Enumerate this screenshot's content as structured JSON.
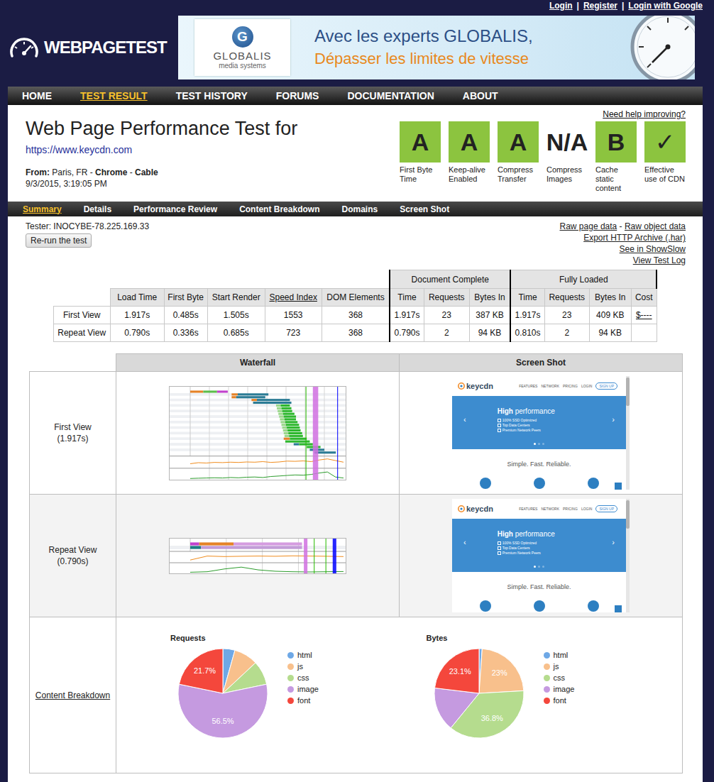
{
  "top_links": {
    "items": [
      "Login",
      "Register",
      "Login with Google"
    ],
    "separator": "|"
  },
  "logo": {
    "text": "WEBPAGETEST"
  },
  "ad": {
    "logo_letter": "G",
    "brand": "GLOBALIS",
    "brand_sub": "media systems",
    "line1": "Avec les experts GLOBALIS,",
    "line2": "Dépasser les limites de vitesse"
  },
  "nav": [
    {
      "label": "HOME",
      "selected": false
    },
    {
      "label": "TEST RESULT",
      "selected": true
    },
    {
      "label": "TEST HISTORY",
      "selected": false
    },
    {
      "label": "FORUMS",
      "selected": false
    },
    {
      "label": "DOCUMENTATION",
      "selected": false
    },
    {
      "label": "ABOUT",
      "selected": false
    }
  ],
  "header": {
    "title": "Web Page Performance Test for",
    "url": "https://www.keycdn.com",
    "from": [
      {
        "text": "From:",
        "bold": true
      },
      {
        "text": " Paris, FR - ",
        "bold": false
      },
      {
        "text": "Chrome",
        "bold": true
      },
      {
        "text": " - ",
        "bold": false
      },
      {
        "text": "Cable",
        "bold": true
      }
    ],
    "date": "9/3/2015, 3:19:05 PM",
    "help_link": "Need help improving?"
  },
  "grades": [
    {
      "grade": "A",
      "label": "First Byte Time",
      "color": "#8cc43f"
    },
    {
      "grade": "A",
      "label": "Keep-alive Enabled",
      "color": "#8cc43f"
    },
    {
      "grade": "A",
      "label": "Compress Transfer",
      "color": "#8cc43f"
    },
    {
      "grade": "N/A",
      "label": "Compress Images",
      "color": "#ffffff"
    },
    {
      "grade": "B",
      "label": "Cache static content",
      "color": "#8cc43f"
    },
    {
      "grade": "✓",
      "label": "Effective use of CDN",
      "color": "#8cc43f"
    }
  ],
  "subnav": [
    {
      "label": "Summary",
      "selected": true
    },
    {
      "label": "Details",
      "selected": false
    },
    {
      "label": "Performance Review",
      "selected": false
    },
    {
      "label": "Content Breakdown",
      "selected": false
    },
    {
      "label": "Domains",
      "selected": false
    },
    {
      "label": "Screen Shot",
      "selected": false
    }
  ],
  "tester": {
    "text": "Tester: INOCYBE-78.225.169.33",
    "button": "Re-run the test"
  },
  "links": {
    "separator": " - ",
    "lines": [
      [
        "Raw page data",
        "Raw object data"
      ],
      [
        "Export HTTP Archive (.har)"
      ],
      [
        "See in ShowSlow"
      ],
      [
        "View Test Log"
      ]
    ]
  },
  "results": {
    "groups": [
      "Document Complete",
      "Fully Loaded"
    ],
    "columns": [
      {
        "label": "Load Time",
        "link": false
      },
      {
        "label": "First Byte",
        "link": false
      },
      {
        "label": "Start Render",
        "link": false
      },
      {
        "label": "Speed Index",
        "link": true
      },
      {
        "label": "DOM Elements",
        "link": false
      },
      {
        "label": "Time",
        "link": false
      },
      {
        "label": "Requests",
        "link": false
      },
      {
        "label": "Bytes In",
        "link": false
      },
      {
        "label": "Time",
        "link": false
      },
      {
        "label": "Requests",
        "link": false
      },
      {
        "label": "Bytes In",
        "link": false
      },
      {
        "label": "Cost",
        "link": false
      }
    ],
    "rows": [
      {
        "label": "First View",
        "cells": [
          "1.917s",
          "0.485s",
          "1.505s",
          "1553",
          "368",
          "1.917s",
          "23",
          "387 KB",
          "1.917s",
          "23",
          "409 KB"
        ],
        "cost": {
          "text": "$----",
          "link": true
        }
      },
      {
        "label": "Repeat View",
        "cells": [
          "0.790s",
          "0.336s",
          "0.685s",
          "723",
          "368",
          "0.790s",
          "2",
          "94 KB",
          "0.810s",
          "2",
          "94 KB"
        ],
        "cost": {
          "text": "",
          "link": false
        }
      }
    ]
  },
  "summary": {
    "headers": [
      "Waterfall",
      "Screen Shot"
    ],
    "views": [
      {
        "label": "First View",
        "time": "(1.917s)",
        "waterfall": {
          "axis_max": 2.0,
          "grid_step": 0.25,
          "requests": [
            {
              "segments": [
                {
                  "start": 0,
                  "end": 0.17,
                  "color": "#e58226"
                },
                {
                  "start": 0.17,
                  "end": 0.35,
                  "color": "#5bbd4b"
                },
                {
                  "start": 0.35,
                  "end": 0.49,
                  "color": "#c141cd"
                }
              ]
            },
            {
              "segments": [
                {
                  "start": 0.54,
                  "end": 0.62,
                  "color": "#e58226"
                },
                {
                  "start": 0.62,
                  "end": 1.02,
                  "color": "#2c7c95"
                }
              ]
            },
            {
              "segments": [
                {
                  "start": 0.54,
                  "end": 0.6,
                  "color": "#e58226"
                },
                {
                  "start": 0.6,
                  "end": 0.98,
                  "color": "#2c7c95"
                }
              ]
            },
            {
              "segments": [
                {
                  "start": 0.8,
                  "end": 0.87,
                  "color": "#e58226"
                },
                {
                  "start": 0.87,
                  "end": 1.3,
                  "color": "#2c7c95"
                }
              ]
            },
            {
              "segments": [
                {
                  "start": 0.82,
                  "end": 1.32,
                  "color": "#2c7c95"
                }
              ]
            },
            {
              "segments": [
                {
                  "start": 1.12,
                  "end": 1.18,
                  "color": "#9ad88a"
                },
                {
                  "start": 1.18,
                  "end": 1.3,
                  "color": "#2eb82e"
                }
              ]
            },
            {
              "segments": [
                {
                  "start": 1.13,
                  "end": 1.19,
                  "color": "#9ad88a"
                },
                {
                  "start": 1.19,
                  "end": 1.32,
                  "color": "#2eb82e"
                }
              ]
            },
            {
              "segments": [
                {
                  "start": 1.14,
                  "end": 1.2,
                  "color": "#9ad88a"
                },
                {
                  "start": 1.2,
                  "end": 1.33,
                  "color": "#2eb82e"
                }
              ]
            },
            {
              "segments": [
                {
                  "start": 1.15,
                  "end": 1.21,
                  "color": "#9ad88a"
                },
                {
                  "start": 1.21,
                  "end": 1.36,
                  "color": "#2eb82e"
                }
              ]
            },
            {
              "segments": [
                {
                  "start": 1.16,
                  "end": 1.22,
                  "color": "#9ad88a"
                },
                {
                  "start": 1.22,
                  "end": 1.38,
                  "color": "#2eb82e"
                }
              ]
            },
            {
              "segments": [
                {
                  "start": 1.17,
                  "end": 1.23,
                  "color": "#9ad88a"
                },
                {
                  "start": 1.23,
                  "end": 1.38,
                  "color": "#2eb82e"
                }
              ]
            },
            {
              "segments": [
                {
                  "start": 1.18,
                  "end": 1.24,
                  "color": "#9ad88a"
                },
                {
                  "start": 1.24,
                  "end": 1.4,
                  "color": "#2eb82e"
                }
              ]
            },
            {
              "segments": [
                {
                  "start": 1.19,
                  "end": 1.25,
                  "color": "#9ad88a"
                },
                {
                  "start": 1.25,
                  "end": 1.42,
                  "color": "#2eb82e"
                }
              ]
            },
            {
              "segments": [
                {
                  "start": 1.2,
                  "end": 1.26,
                  "color": "#9ad88a"
                },
                {
                  "start": 1.26,
                  "end": 1.43,
                  "color": "#2eb82e"
                }
              ]
            },
            {
              "segments": [
                {
                  "start": 1.21,
                  "end": 1.27,
                  "color": "#9ad88a"
                },
                {
                  "start": 1.27,
                  "end": 1.44,
                  "color": "#2eb82e"
                }
              ]
            },
            {
              "segments": [
                {
                  "start": 1.22,
                  "end": 1.28,
                  "color": "#9ad88a"
                },
                {
                  "start": 1.28,
                  "end": 1.46,
                  "color": "#2eb82e"
                }
              ]
            },
            {
              "segments": [
                {
                  "start": 1.23,
                  "end": 1.29,
                  "color": "#9ad88a"
                },
                {
                  "start": 1.29,
                  "end": 1.47,
                  "color": "#2eb82e"
                }
              ]
            },
            {
              "segments": [
                {
                  "start": 1.22,
                  "end": 1.3,
                  "color": "#e58226"
                },
                {
                  "start": 1.3,
                  "end": 1.52,
                  "color": "#2eb82e"
                }
              ]
            },
            {
              "segments": [
                {
                  "start": 1.24,
                  "end": 1.56,
                  "color": "#2eb82e"
                }
              ]
            },
            {
              "segments": [
                {
                  "start": 1.35,
                  "end": 1.42,
                  "color": "#2c7c95"
                },
                {
                  "start": 1.42,
                  "end": 1.6,
                  "color": "#2eb82e"
                }
              ]
            },
            {
              "segments": [
                {
                  "start": 1.52,
                  "end": 1.7,
                  "color": "#2eb82e"
                }
              ]
            },
            {
              "segments": [
                {
                  "start": 1.56,
                  "end": 1.75,
                  "color": "#2c7c95"
                }
              ]
            },
            {
              "segments": [
                {
                  "start": 1.62,
                  "end": 1.9,
                  "color": "#2c7c95"
                }
              ]
            }
          ],
          "markers": [
            {
              "start": 1.505,
              "end": 1.505,
              "color": "#28bc00"
            },
            {
              "start": 1.6,
              "end": 1.67,
              "color": "#d070e0"
            },
            {
              "start": 1.917,
              "end": 1.917,
              "color": "#0000ff"
            }
          ],
          "cpu": [
            35,
            45,
            42,
            48,
            46,
            50,
            47,
            52,
            50,
            55,
            48,
            52,
            60,
            58,
            62,
            55,
            70,
            80,
            65,
            50
          ],
          "bandwidth": [
            5,
            8,
            10,
            12,
            10,
            15,
            12,
            18,
            20,
            15,
            25,
            30,
            35,
            40,
            38,
            45,
            60,
            70,
            20,
            10
          ]
        },
        "screenshot": {
          "logo": "keycdn",
          "nav": [
            "FEATURES",
            "NETWORK",
            "PRICING",
            "LOGIN"
          ],
          "signup": "SIGN UP",
          "arrow_left": "‹",
          "arrow_right": "›",
          "hero_bold": "High",
          "hero_rest": "performance",
          "features": [
            "100% SSD Optimized",
            "Top Data Centers",
            "Premium Network Peers"
          ],
          "slides": [
            {
              "selected": true
            },
            {
              "selected": false
            },
            {
              "selected": false
            }
          ],
          "tagline": "Simple. Fast. Reliable."
        }
      },
      {
        "label": "Repeat View",
        "time": "(0.790s)",
        "waterfall": {
          "axis_max": 0.85,
          "grid_step": 0.2,
          "requests": [
            {
              "segments": [
                {
                  "start": 0,
                  "end": 0.05,
                  "color": "#c141cd"
                },
                {
                  "start": 0.05,
                  "end": 0.24,
                  "color": "#e58226"
                },
                {
                  "start": 0.24,
                  "end": 0.62,
                  "color": "#d59be0"
                }
              ]
            },
            {
              "segments": [
                {
                  "start": 0,
                  "end": 0.06,
                  "color": "#1f7c83"
                },
                {
                  "start": 0.06,
                  "end": 0.62,
                  "color": "#c39bd8"
                }
              ]
            }
          ],
          "markers": [
            {
              "start": 0.63,
              "end": 0.65,
              "color": "#d070e0"
            },
            {
              "start": 0.685,
              "end": 0.685,
              "color": "#28bc00"
            },
            {
              "start": 0.75,
              "end": 0.75,
              "color": "#28bc00"
            },
            {
              "start": 0.79,
              "end": 0.81,
              "color": "#0000ff"
            }
          ],
          "cpu": [
            20,
            60,
            55,
            58,
            60,
            58,
            62,
            60,
            58,
            55
          ],
          "bandwidth": [
            5,
            10,
            40,
            60,
            30,
            15,
            10,
            8,
            10,
            12
          ]
        },
        "screenshot": {
          "logo": "keycdn",
          "nav": [
            "FEATURES",
            "NETWORK",
            "PRICING",
            "LOGIN"
          ],
          "signup": "SIGN UP",
          "arrow_left": "‹",
          "arrow_right": "›",
          "hero_bold": "High",
          "hero_rest": "performance",
          "features": [
            "100% SSD Optimized",
            "Top Data Centers",
            "Premium Network Peers"
          ],
          "slides": [
            {
              "selected": true
            },
            {
              "selected": false
            },
            {
              "selected": false
            }
          ],
          "tagline": "Simple. Fast. Reliable."
        }
      }
    ],
    "breakdown": {
      "label": "Content Breakdown",
      "charts": [
        {
          "title": "Requests",
          "slices": [
            {
              "name": "html",
              "value": 1,
              "label": "",
              "color": "#6ea8e6"
            },
            {
              "name": "js",
              "value": 2,
              "label": "",
              "color": "#f8c08c"
            },
            {
              "name": "css",
              "value": 2,
              "label": "",
              "color": "#b5dc8e"
            },
            {
              "name": "image",
              "value": 13,
              "label": "56.5%",
              "color": "#c59ae0"
            },
            {
              "name": "font",
              "value": 5,
              "label": "21.7%",
              "color": "#f4473c"
            }
          ]
        },
        {
          "title": "Bytes",
          "slices": [
            {
              "name": "html",
              "value": 1.1,
              "label": "",
              "color": "#6ea8e6"
            },
            {
              "name": "js",
              "value": 23,
              "label": "23%",
              "color": "#f8c08c"
            },
            {
              "name": "css",
              "value": 36.8,
              "label": "36.8%",
              "color": "#b5dc8e"
            },
            {
              "name": "image",
              "value": 16,
              "label": "",
              "color": "#c59ae0"
            },
            {
              "name": "font",
              "value": 23.1,
              "label": "23.1%",
              "color": "#f4473c"
            }
          ]
        }
      ]
    }
  }
}
